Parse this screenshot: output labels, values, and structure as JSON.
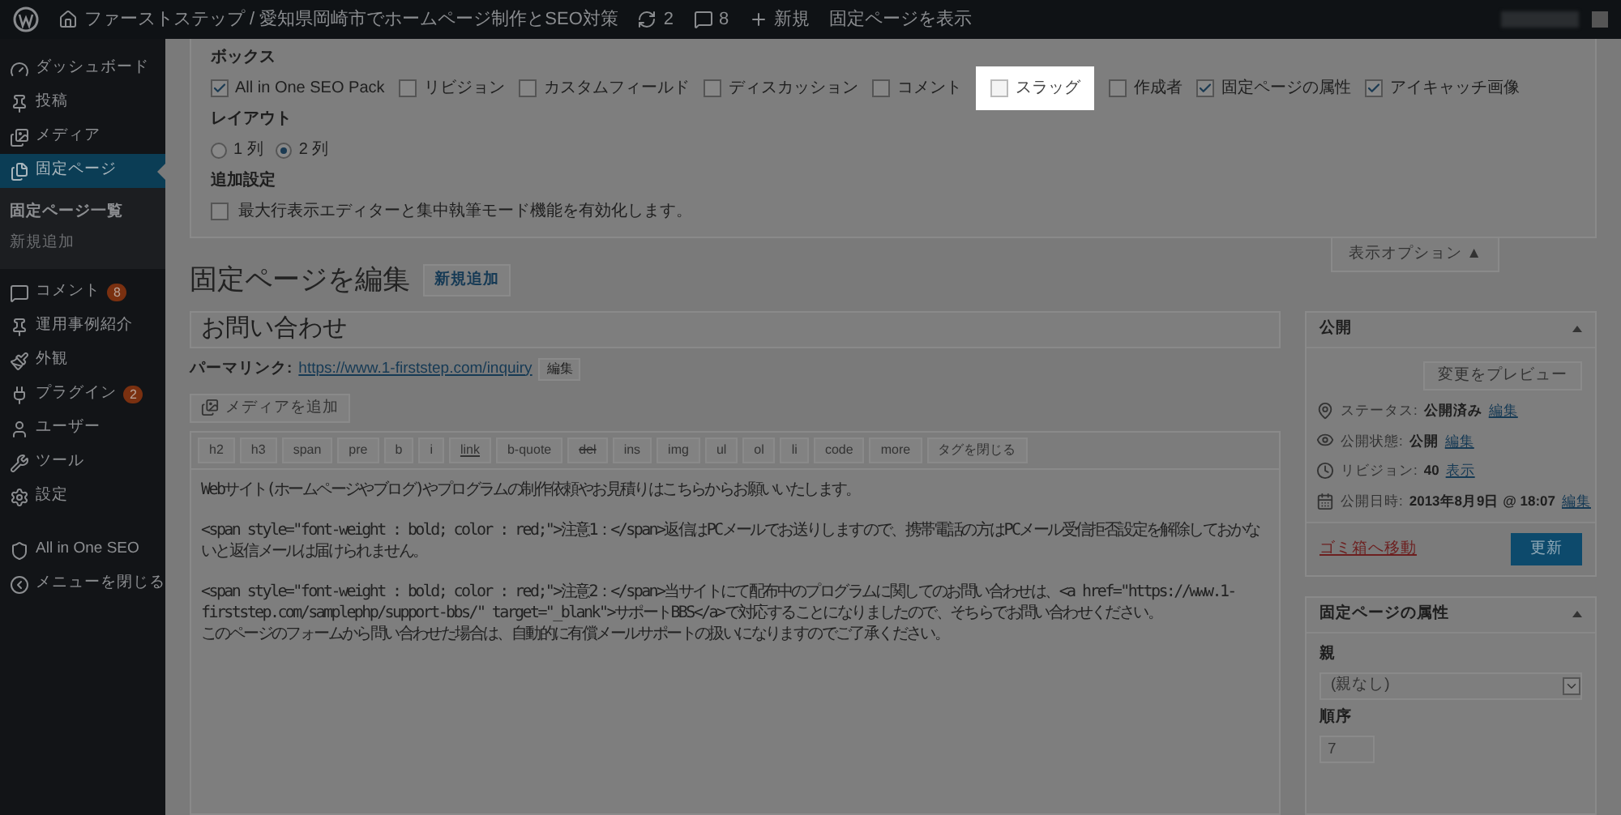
{
  "admin_bar": {
    "site_title": "ファーストステップ / 愛知県岡崎市でホームページ制作とSEO対策",
    "updates": "2",
    "comments": "8",
    "new": "新規",
    "view_page": "固定ページを表示"
  },
  "sidebar": {
    "items": [
      {
        "label": "ダッシュボード",
        "selected": false
      },
      {
        "label": "投稿",
        "selected": false
      },
      {
        "label": "メディア",
        "selected": false
      },
      {
        "label": "固定ページ",
        "selected": true,
        "children": [
          {
            "label": "固定ページ一覧",
            "selected": true
          },
          {
            "label": "新規追加",
            "selected": false
          }
        ]
      },
      {
        "label": "コメント",
        "selected": false,
        "badge": "8"
      },
      {
        "label": "運用事例紹介",
        "selected": false
      },
      {
        "label": "外観",
        "selected": false
      },
      {
        "label": "プラグイン",
        "selected": false,
        "badge": "2"
      },
      {
        "label": "ユーザー",
        "selected": false
      },
      {
        "label": "ツール",
        "selected": false
      },
      {
        "label": "設定",
        "selected": false
      },
      {
        "label": "All in One SEO",
        "selected": false
      },
      {
        "label": "メニューを閉じる",
        "selected": false
      }
    ]
  },
  "screen_options": {
    "boxes_title": "ボックス",
    "boxes": [
      {
        "label": "All in One SEO Pack",
        "checked": true,
        "highlighted": false
      },
      {
        "label": "リビジョン",
        "checked": false,
        "highlighted": false
      },
      {
        "label": "カスタムフィールド",
        "checked": false,
        "highlighted": false
      },
      {
        "label": "ディスカッション",
        "checked": false,
        "highlighted": false
      },
      {
        "label": "コメント",
        "checked": false,
        "highlighted": false
      },
      {
        "label": "スラッグ",
        "checked": false,
        "highlighted": true
      },
      {
        "label": "作成者",
        "checked": false,
        "highlighted": false
      },
      {
        "label": "固定ページの属性",
        "checked": true,
        "highlighted": false
      },
      {
        "label": "アイキャッチ画像",
        "checked": true,
        "highlighted": false
      }
    ],
    "layout_title": "レイアウト",
    "layout": [
      {
        "label": "1 列",
        "selected": false
      },
      {
        "label": "2 列",
        "selected": true
      }
    ],
    "extra_title": "追加設定",
    "extra": [
      {
        "label": "最大行表示エディターと集中執筆モード機能を有効化します。",
        "checked": false
      }
    ],
    "toggle_label": "表示オプション ▲"
  },
  "editor": {
    "heading": "固定ページを編集",
    "add_new": "新規追加",
    "title_value": "お問い合わせ",
    "permalink_label": "パーマリンク:",
    "permalink_url": "https://www.1-firststep.com/inquiry",
    "permalink_edit": "編集",
    "add_media": "メディアを追加",
    "quicktags": [
      {
        "label": "h2",
        "kind": "plain"
      },
      {
        "label": "h3",
        "kind": "plain"
      },
      {
        "label": "span",
        "kind": "plain"
      },
      {
        "label": "pre",
        "kind": "plain"
      },
      {
        "label": "b",
        "kind": "plain"
      },
      {
        "label": "i",
        "kind": "plain"
      },
      {
        "label": "link",
        "kind": "underline"
      },
      {
        "label": "b-quote",
        "kind": "plain"
      },
      {
        "label": "del",
        "kind": "strike"
      },
      {
        "label": "ins",
        "kind": "plain"
      },
      {
        "label": "img",
        "kind": "plain"
      },
      {
        "label": "ul",
        "kind": "plain"
      },
      {
        "label": "ol",
        "kind": "plain"
      },
      {
        "label": "li",
        "kind": "plain"
      },
      {
        "label": "code",
        "kind": "plain"
      },
      {
        "label": "more",
        "kind": "plain"
      },
      {
        "label": "タグを閉じる",
        "kind": "plain"
      }
    ],
    "content_paragraphs": [
      [
        "Webサイト(ホームページやブログ)やプログラムの制作依頼やお見積りはこちらからお願いいたします。"
      ],
      [
        "<span style=\"font-weight : bold; color : red;\">注意1：</span>返信はPCメールでお送りしますので、携帯電話の方はPCメール受信拒否設定を解除しておかな",
        "いと返信メールは届けられません。"
      ],
      [
        "<span style=\"font-weight : bold; color : red;\">注意2：</span>当サイトにて配布中のプログラムに関してのお問い合わせは、<a href=\"https://www.1-",
        "firststep.com/samplephp/support-bbs/\" target=\"_blank\">サポートBBS</a>で対応することになりましたので、そちらでお問い合わせください。",
        "このページのフォームから問い合わせた場合は、自動的に有償メールサポートの扱いになりますのでご了承ください。"
      ]
    ]
  },
  "publish": {
    "title": "公開",
    "preview": "変更をプレビュー",
    "rows": [
      {
        "kind": "status",
        "label": "ステータス:",
        "value": "公開済み",
        "link": "編集"
      },
      {
        "kind": "visibility",
        "label": "公開状態:",
        "value": "公開",
        "link": "編集"
      },
      {
        "kind": "revisions",
        "label": "リビジョン:",
        "value": "40",
        "link": "表示"
      },
      {
        "kind": "date",
        "label": "公開日時:",
        "value": "2013年8月9日 @ 18:07",
        "link": "編集"
      }
    ],
    "trash": "ゴミ箱へ移動",
    "update": "更新"
  },
  "attributes": {
    "title": "固定ページの属性",
    "parent_label": "親",
    "parent_value": "(親なし)",
    "order_label": "順序",
    "order_value": "7"
  }
}
